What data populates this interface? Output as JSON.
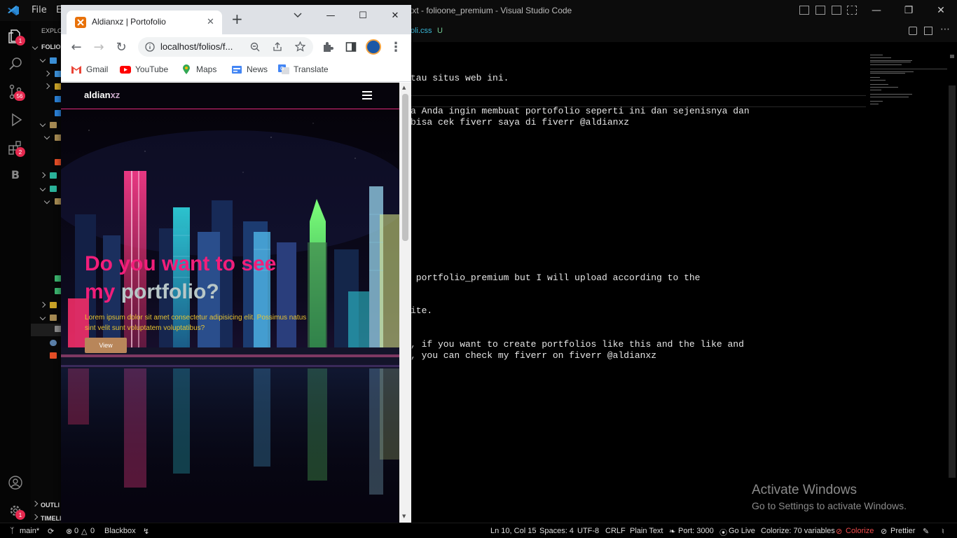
{
  "vscode": {
    "title": "txt - folioone_premium - Visual Studio Code",
    "menu": {
      "file": "File",
      "edit": "E"
    },
    "sidebar": {
      "title": "EXPLO",
      "root": "FOLIO",
      "outline": "OUTLI",
      "timeline": "TIMELI"
    },
    "badges": {
      "explorer": "1",
      "scm": "56",
      "extensions": "2",
      "settings": "1"
    },
    "tab": {
      "file": "oli.css",
      "status": "U"
    },
    "editor_lines": [
      "tau situs web ini.",
      "a Anda ingin membuat portofolio seperti ini dan sejenisnya dan",
      "bisa cek fiverr saya di fiverr @aldianxz",
      " portfolio_premium but I will upload according to the",
      "ite.",
      ", if you want to create portfolios like this and the like and",
      ", you can check my fiverr on fiverr @aldianxz"
    ],
    "watermark": {
      "line1": "Activate Windows",
      "line2": "Go to Settings to activate Windows."
    },
    "status": {
      "branch": "main*",
      "problems": "0",
      "warnings": "0",
      "blackbox": "Blackbox",
      "position": "Ln 10, Col 15",
      "spaces": "Spaces: 4",
      "encoding": "UTF-8",
      "eol": "CRLF",
      "language": "Plain Text",
      "port": "Port: 3000",
      "golive": "Go Live",
      "colorize_vars": "Colorize: 70 variables",
      "colorize": "Colorize",
      "prettier": "Prettier"
    },
    "colors": {
      "badge": "#e5294f",
      "colorize": "#f14c4c"
    }
  },
  "chrome": {
    "tab_title": "Aldianxz | Portofolio",
    "new_tab": "+",
    "url": "localhost/folios/f...",
    "bookmarks": [
      "Gmail",
      "YouTube",
      "Maps",
      "News",
      "Translate"
    ]
  },
  "site": {
    "brand_main": "aldian",
    "brand_accent": "xz",
    "hero_title_line1": "Do you want to see",
    "hero_title_my": "my ",
    "hero_title_accent": "portfolio?",
    "hero_body": "Lorem ipsum dolor sit amet consectetur adipisicing elit. Possimus natus sint velit sunt voluptatem voluptatibus?",
    "hero_button": "View",
    "colors": {
      "title": "#f21e7a",
      "accent": "#b8c7c7",
      "body": "#e6c331",
      "button": "#b8865a",
      "nav_border": "#e0287a"
    }
  }
}
